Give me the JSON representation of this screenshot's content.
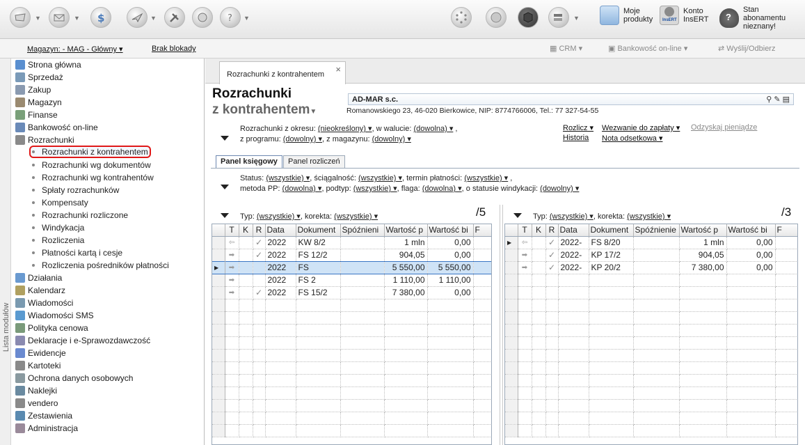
{
  "topbar": {
    "moje_produkty": "Moje produkty",
    "konto_insert": "Konto InsERT",
    "konto_small": "InsERT",
    "stan": "Stan abonamentu nieznany!"
  },
  "bar2": {
    "magazyn": "Magazyn: - MAG - Główny",
    "brak_blokady": "Brak blokady",
    "crm": "CRM",
    "bankowosc": "Bankowość on-line",
    "wyslij": "Wyślij/Odbierz"
  },
  "sidebar": {
    "vertical_label": "Lista modułów",
    "items": [
      {
        "label": "Strona główna",
        "icon": "home-icon"
      },
      {
        "label": "Sprzedaż",
        "icon": "sales-icon"
      },
      {
        "label": "Zakup",
        "icon": "purchase-icon"
      },
      {
        "label": "Magazyn",
        "icon": "warehouse-icon"
      },
      {
        "label": "Finanse",
        "icon": "finance-icon"
      },
      {
        "label": "Bankowość on-line",
        "icon": "bank-icon"
      },
      {
        "label": "Rozrachunki",
        "icon": "settlements-icon"
      }
    ],
    "subitems": [
      "Rozrachunki z kontrahentem",
      "Rozrachunki wg dokumentów",
      "Rozrachunki wg kontrahentów",
      "Spłaty rozrachunków",
      "Kompensaty",
      "Rozrachunki rozliczone",
      "Windykacja",
      "Rozliczenia",
      "Płatności kartą i cesje",
      "Rozliczenia pośredników płatności"
    ],
    "items2": [
      {
        "label": "Działania",
        "icon": "actions-icon"
      },
      {
        "label": "Kalendarz",
        "icon": "calendar-icon"
      },
      {
        "label": "Wiadomości",
        "icon": "messages-icon"
      },
      {
        "label": "Wiadomości SMS",
        "icon": "sms-icon"
      },
      {
        "label": "Polityka cenowa",
        "icon": "pricing-icon"
      },
      {
        "label": "Deklaracje i e-Sprawozdawczość",
        "icon": "declarations-icon"
      },
      {
        "label": "Ewidencje",
        "icon": "records-icon"
      },
      {
        "label": "Kartoteki",
        "icon": "files-icon"
      },
      {
        "label": "Ochrona danych osobowych",
        "icon": "shield-icon"
      },
      {
        "label": "Naklejki",
        "icon": "stickers-icon"
      },
      {
        "label": "vendero",
        "icon": "vendero-icon"
      },
      {
        "label": "Zestawienia",
        "icon": "reports-icon"
      },
      {
        "label": "Administracja",
        "icon": "admin-icon"
      }
    ]
  },
  "main": {
    "tab_label": "Rozrachunki z kontrahentem",
    "title": "Rozrachunki",
    "subtitle": "z kontrahentem",
    "contractor_name": "AD-MAR s.c.",
    "contractor_address": "Romanowskiego 23, 46-020 Bierkowice, NIP: 8774766006, Tel.: 77 327-54-55",
    "filter_okres_label": "Rozrachunki z okresu:",
    "filter_okres_value": "(nieokreślony)",
    "filter_waluta_label": ", w walucie:",
    "filter_waluta_value": "(dowolna)",
    "filter_program_label": "z programu:",
    "filter_program_value": "(dowolny)",
    "filter_magazyn_label": ", z magazynu:",
    "filter_magazyn_value": "(dowolny)",
    "link_rozlicz": "Rozlicz",
    "link_wezwanie": "Wezwanie do zapłaty",
    "link_odzyskaj": "Odzyskaj pieniądze",
    "link_historia": "Historia",
    "link_nota": "Nota odsetkowa",
    "panel_tab1": "Panel księgowy",
    "panel_tab2": "Panel rozliczeń",
    "status_label": "Status:",
    "status_value": "(wszystkie)",
    "sciagalnosc_label": ", ściągalność:",
    "sciagalnosc_value": "(wszystkie)",
    "termin_label": ", termin płatności:",
    "termin_value": "(wszystkie)",
    "metoda_label": "metoda PP:",
    "metoda_value": "(dowolna)",
    "podtyp_label": ", podtyp:",
    "podtyp_value": "(wszystkie)",
    "flaga_label": ", flaga:",
    "flaga_value": "(dowolna)",
    "windykacja_label": ", o statusie windykacji:",
    "windykacja_value": "(dowolny)"
  },
  "left_grid": {
    "typ_label": "Typ:",
    "typ_value": "(wszystkie)",
    "korekta_label": ", korekta:",
    "korekta_value": "(wszystkie)",
    "count": "/5",
    "columns": [
      "T",
      "K",
      "R",
      "Data",
      "Dokument",
      "Spóźnieni",
      "Wartość p",
      "Wartość bi",
      "F"
    ],
    "rows": [
      {
        "t": "⇦",
        "k": "",
        "r": "✓",
        "data": "2022",
        "dok": "KW 8/2",
        "spoz": "",
        "wp": "1 mln",
        "wb": "0,00",
        "f": ""
      },
      {
        "t": "➡",
        "k": "",
        "r": "✓",
        "data": "2022",
        "dok": "FS 12/2",
        "spoz": "",
        "wp": "904,05",
        "wb": "0,00",
        "f": ""
      },
      {
        "t": "➡",
        "k": "",
        "r": "",
        "data": "2022",
        "dok": "FS",
        "spoz": "",
        "wp": "5 550,00",
        "wb": "5 550,00",
        "f": ""
      },
      {
        "t": "➡",
        "k": "",
        "r": "",
        "data": "2022",
        "dok": "FS 2",
        "spoz": "",
        "wp": "1 110,00",
        "wb": "1 110,00",
        "f": ""
      },
      {
        "t": "➡",
        "k": "",
        "r": "✓",
        "data": "2022",
        "dok": "FS 15/2",
        "spoz": "",
        "wp": "7 380,00",
        "wb": "0,00",
        "f": ""
      }
    ]
  },
  "right_grid": {
    "typ_label": "Typ:",
    "typ_value": "(wszystkie)",
    "korekta_label": ", korekta:",
    "korekta_value": "(wszystkie)",
    "count": "/3",
    "columns": [
      "T",
      "K",
      "R",
      "Data",
      "Dokument",
      "Spóźnienie",
      "Wartość p",
      "Wartość bi",
      "F"
    ],
    "rows": [
      {
        "t": "⇦",
        "k": "",
        "r": "✓",
        "data": "2022-",
        "dok": "FS 8/20",
        "spoz": "",
        "wp": "1 mln",
        "wb": "0,00",
        "f": ""
      },
      {
        "t": "➡",
        "k": "",
        "r": "✓",
        "data": "2022-",
        "dok": "KP 17/2",
        "spoz": "",
        "wp": "904,05",
        "wb": "0,00",
        "f": ""
      },
      {
        "t": "➡",
        "k": "",
        "r": "✓",
        "data": "2022-",
        "dok": "KP 20/2",
        "spoz": "",
        "wp": "7 380,00",
        "wb": "0,00",
        "f": ""
      }
    ]
  },
  "colors": {
    "selection": "#cfe3f6",
    "highlight_border": "#e01818"
  }
}
